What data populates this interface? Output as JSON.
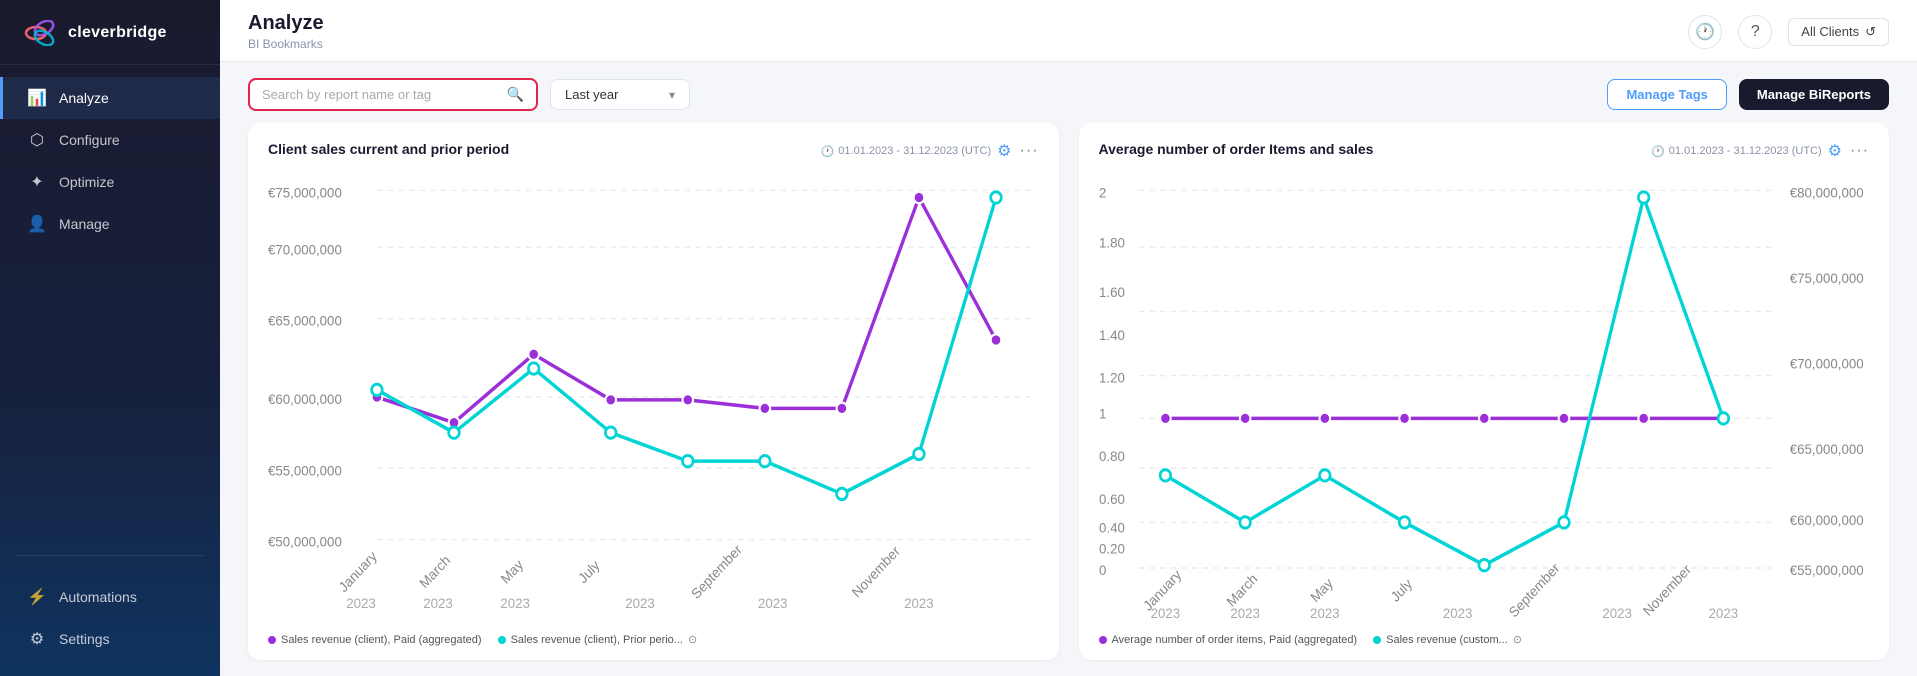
{
  "sidebar": {
    "logo_text": "cleverbridge",
    "items": [
      {
        "id": "analyze",
        "label": "Analyze",
        "icon": "📊",
        "active": true
      },
      {
        "id": "configure",
        "label": "Configure",
        "icon": "⬡"
      },
      {
        "id": "optimize",
        "label": "Optimize",
        "icon": "✦"
      },
      {
        "id": "manage",
        "label": "Manage",
        "icon": "👤"
      }
    ],
    "bottom_items": [
      {
        "id": "automations",
        "label": "Automations",
        "icon": "⚡"
      },
      {
        "id": "settings",
        "label": "Settings",
        "icon": "⚙"
      }
    ]
  },
  "header": {
    "title": "Analyze",
    "breadcrumb": "BI Bookmarks",
    "all_clients_label": "All Clients"
  },
  "toolbar": {
    "search_placeholder": "Search by report name or tag",
    "period_label": "Last year",
    "manage_tags_label": "Manage Tags",
    "manage_bireports_label": "Manage BiReports"
  },
  "charts": [
    {
      "id": "chart1",
      "title": "Client sales current and prior period",
      "date_range": "01.01.2023 - 31.12.2023 (UTC)",
      "legend": [
        {
          "label": "Sales revenue (client), Paid (aggregated)",
          "color": "#9b30d9"
        },
        {
          "label": "Sales revenue (client), Prior perio...",
          "color": "#00d4d4"
        }
      ]
    },
    {
      "id": "chart2",
      "title": "Average number of order Items and sales",
      "date_range": "01.01.2023 - 31.12.2023 (UTC)",
      "legend": [
        {
          "label": "Average number of order items, Paid (aggregated)",
          "color": "#9b30d9"
        },
        {
          "label": "Sales revenue (custom...",
          "color": "#00d4d4"
        }
      ]
    }
  ]
}
